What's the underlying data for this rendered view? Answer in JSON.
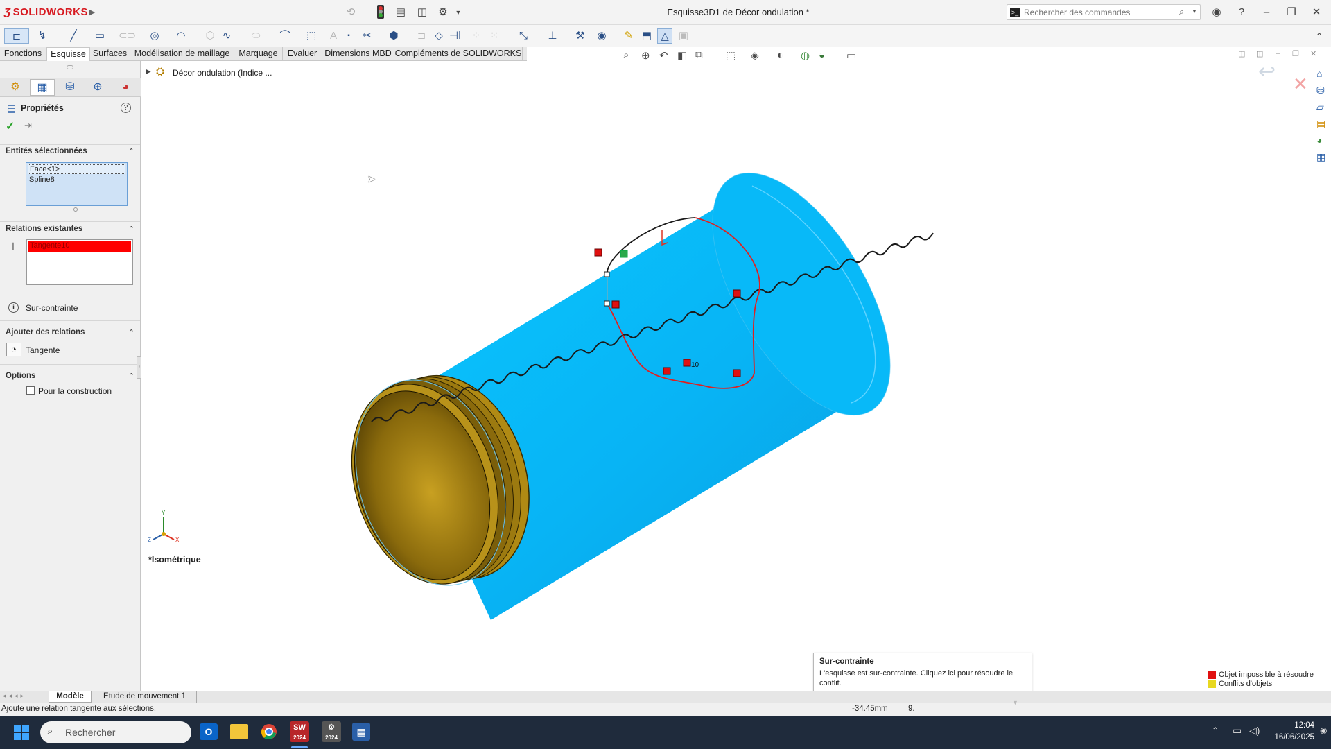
{
  "app": {
    "brand": "SOLIDWORKS",
    "window_title": "Esquisse3D1 de Décor ondulation *",
    "command_search_placeholder": "Rechercher des commandes"
  },
  "tabs": [
    {
      "label": "Fonctions"
    },
    {
      "label": "Esquisse"
    },
    {
      "label": "Surfaces"
    },
    {
      "label": "Modélisation de maillage"
    },
    {
      "label": "Marquage"
    },
    {
      "label": "Evaluer"
    },
    {
      "label": "Dimensions MBD"
    },
    {
      "label": "Compléments de SOLIDWORKS"
    }
  ],
  "active_tab": "Esquisse",
  "property_manager": {
    "title": "Propriétés",
    "selected_entities": {
      "header": "Entités sélectionnées",
      "items": [
        "Face<1>",
        "Spline8"
      ]
    },
    "existing_relations": {
      "header": "Relations existantes",
      "items": [
        "Tangente10"
      ],
      "status": "Sur-contrainte"
    },
    "add_relations": {
      "header": "Ajouter des relations",
      "items": [
        "Tangente"
      ]
    },
    "options": {
      "header": "Options",
      "construction_label": "Pour la construction",
      "construction_checked": false
    }
  },
  "feature_tree": {
    "root_label": "Décor ondulation  (Indice ..."
  },
  "viewport": {
    "view_name": "*Isométrique",
    "dimension_label": "10",
    "triad": {
      "x": "X",
      "y": "Y",
      "z": "Z"
    },
    "colors": {
      "cylinder": "#08b4f5",
      "cap": "#9a7a10",
      "sketch_conflict": "#e02020",
      "spline": "#1a1a1a"
    }
  },
  "tooltip": {
    "title": "Sur-contrainte",
    "body": "L'esquisse est sur-contrainte. Cliquez ici pour résoudre le conflit."
  },
  "legend": [
    {
      "label": "Objet impossible à résoudre",
      "color": "#e01010"
    },
    {
      "label": "Conflits d'objets",
      "color": "#e8d820"
    }
  ],
  "bottom_tabs": [
    {
      "label": "Modèle"
    },
    {
      "label": "Etude de mouvement 1"
    }
  ],
  "status": {
    "message": "Ajoute une relation tangente aux sélections.",
    "coordinate": "-34.45mm",
    "value2": "9."
  },
  "taskbar": {
    "search_placeholder": "Rechercher",
    "time": "12:04",
    "date": "16/06/2025",
    "sw_badge": "2024"
  }
}
